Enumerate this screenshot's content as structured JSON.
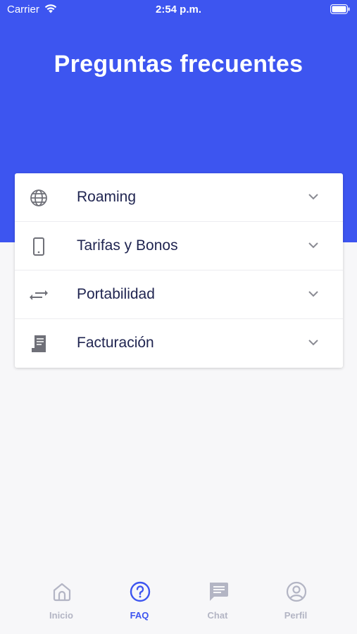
{
  "status": {
    "carrier": "Carrier",
    "time": "2:54 p.m."
  },
  "header": {
    "title": "Preguntas frecuentes"
  },
  "faq": {
    "items": [
      {
        "label": "Roaming",
        "icon": "globe-icon"
      },
      {
        "label": "Tarifas y Bonos",
        "icon": "smartphone-icon"
      },
      {
        "label": "Portabilidad",
        "icon": "swap-arrows-icon"
      },
      {
        "label": "Facturación",
        "icon": "receipt-icon"
      }
    ]
  },
  "tabs": [
    {
      "label": "Inicio",
      "icon": "home-icon",
      "active": false
    },
    {
      "label": "FAQ",
      "icon": "help-circle-icon",
      "active": true
    },
    {
      "label": "Chat",
      "icon": "chat-icon",
      "active": false
    },
    {
      "label": "Perfil",
      "icon": "profile-icon",
      "active": false
    }
  ],
  "colors": {
    "primary": "#3d55f0",
    "text_dark": "#1f2450",
    "inactive": "#b3b5c4",
    "icon_gray": "#6f7078"
  }
}
